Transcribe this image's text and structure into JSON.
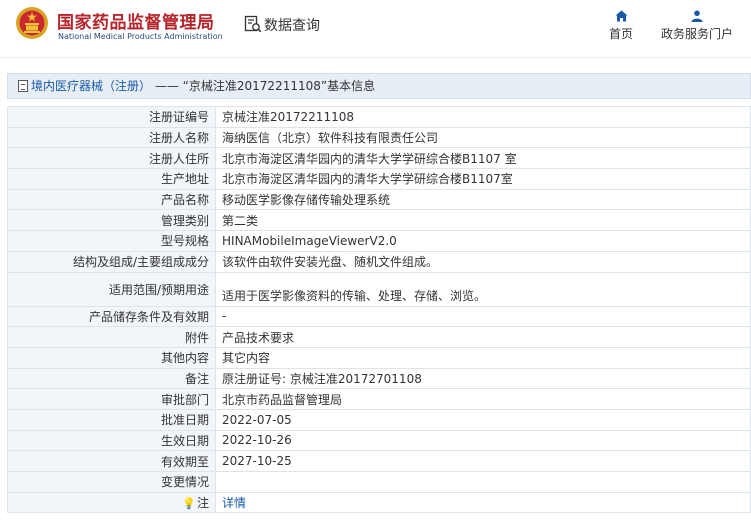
{
  "header": {
    "logo_cn": "国家药品监督管理局",
    "logo_en": "National Medical Products Administration",
    "query_label": "数据查询",
    "nav": [
      {
        "label": "首页",
        "icon": "home-icon"
      },
      {
        "label": "政务服务门户",
        "icon": "user-icon"
      }
    ]
  },
  "title_bar": {
    "crumb": "境内医疗器械（注册）",
    "separator": "——",
    "title": "“京械注准20172211108”基本信息"
  },
  "rows": [
    {
      "key": "注册证编号",
      "value": "京械注准20172211108"
    },
    {
      "key": "注册人名称",
      "value": "海纳医信（北京）软件科技有限责任公司"
    },
    {
      "key": "注册人住所",
      "value": "北京市海淀区清华园内的清华大学学研综合楼B1107 室"
    },
    {
      "key": "生产地址",
      "value": "北京市海淀区清华园内的清华大学学研综合楼B1107室"
    },
    {
      "key": "产品名称",
      "value": "移动医学影像存储传输处理系统"
    },
    {
      "key": "管理类别",
      "value": "第二类"
    },
    {
      "key": "型号规格",
      "value": "HINAMobileImageViewerV2.0"
    },
    {
      "key": "结构及组成/主要组成成分",
      "value": "该软件由软件安装光盘、随机文件组成。"
    },
    {
      "key": "适用范围/预期用途",
      "value": "适用于医学影像资料的传输、处理、存储、浏览。"
    },
    {
      "key": "产品储存条件及有效期",
      "value": "-"
    },
    {
      "key": "附件",
      "value": "产品技术要求"
    },
    {
      "key": "其他内容",
      "value": "其它内容"
    },
    {
      "key": "备注",
      "value": "原注册证号: 京械注准20172701108"
    },
    {
      "key": "审批部门",
      "value": "北京市药品监督管理局"
    },
    {
      "key": "批准日期",
      "value": "2022-07-05"
    },
    {
      "key": "生效日期",
      "value": "2022-10-26"
    },
    {
      "key": "有效期至",
      "value": "2027-10-25"
    },
    {
      "key": "变更情况",
      "value": ""
    },
    {
      "key": "注",
      "value": "详情"
    }
  ],
  "colors": {
    "brand_red": "#b5262c",
    "link_blue": "#1a5aa8",
    "title_bg": "#e8eef6",
    "label_bg": "#f2f5f9"
  }
}
